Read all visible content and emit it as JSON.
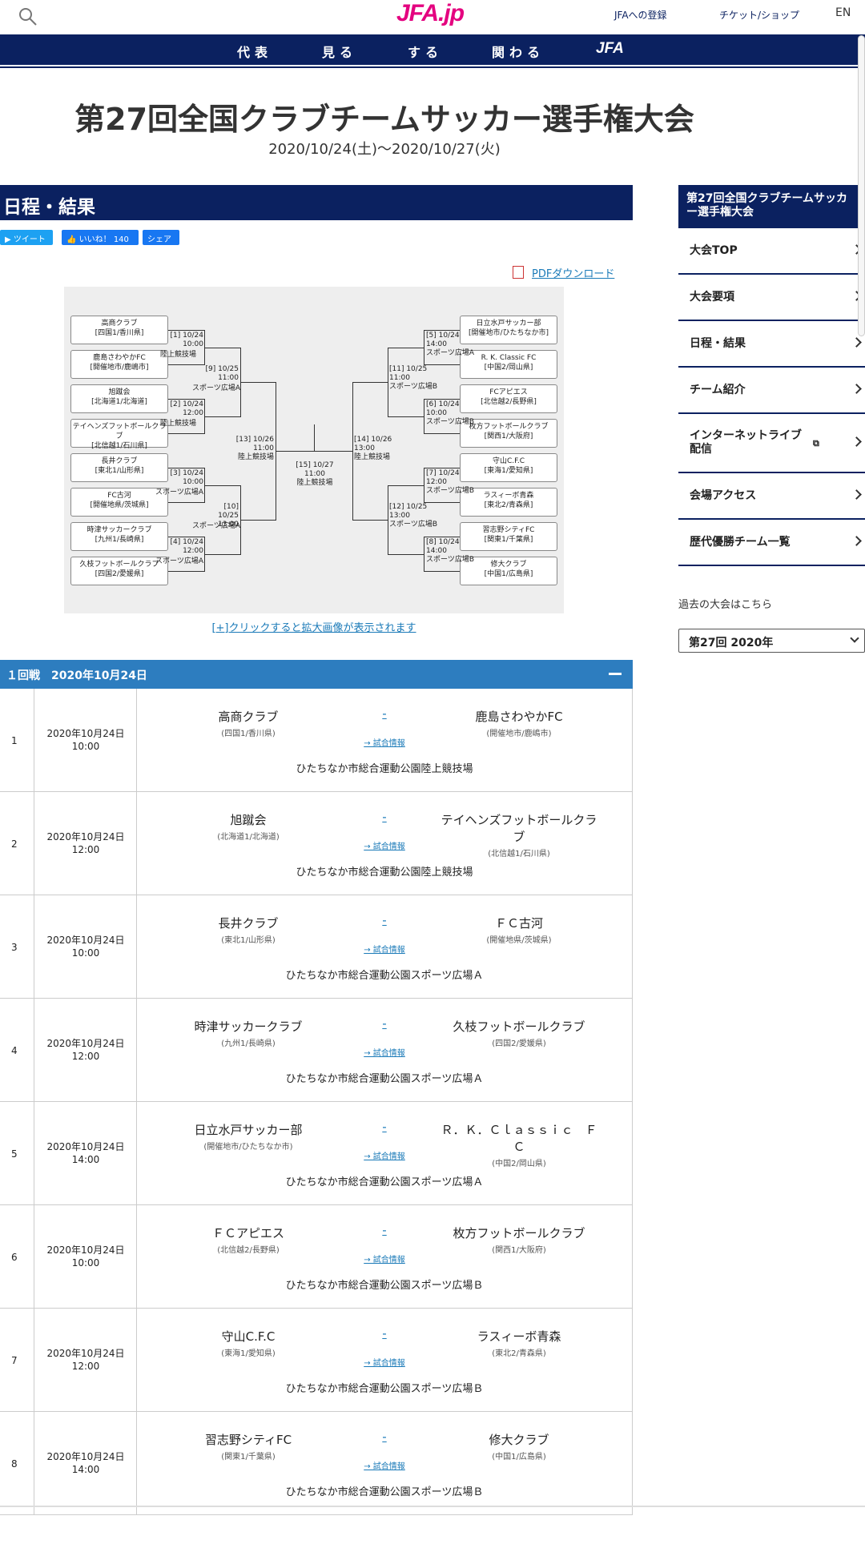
{
  "header": {
    "logo": "JFA.jp",
    "register": "JFAへの登録",
    "tickets": "チケット/ショップ",
    "lang": "EN",
    "nav": [
      "代表",
      "見る",
      "する",
      "関わる"
    ],
    "nav_jfa": "JFA"
  },
  "page": {
    "title": "第27回全国クラブチームサッカー選手権大会",
    "dates": "2020/10/24(土)〜2020/10/27(火)",
    "section": "日程・結果",
    "tweet": "ツイート",
    "like": "いいね！ 140",
    "share": "シェア",
    "pdf": "PDFダウンロード",
    "zoom_link": "[+]クリックすると拡大画像が表示されます"
  },
  "bracket": {
    "left_teams": [
      [
        "高商クラブ",
        "[四国1/香川県]"
      ],
      [
        "鹿島さわやかFC",
        "[開催地市/鹿嶋市]"
      ],
      [
        "旭蹴会",
        "[北海道1/北海道]"
      ],
      [
        "テイヘンズフットボールクラブ",
        "[北信越1/石川県]"
      ],
      [
        "長井クラブ",
        "[東北1/山形県]"
      ],
      [
        "FC古河",
        "[開催地県/茨城県]"
      ],
      [
        "時津サッカークラブ",
        "[九州1/長崎県]"
      ],
      [
        "久枝フットボールクラブ",
        "[四国2/愛媛県]"
      ]
    ],
    "right_teams": [
      [
        "日立水戸サッカー部",
        "[開催地市/ひたちなか市]"
      ],
      [
        "R. K. Classic FC",
        "[中国2/岡山県]"
      ],
      [
        "FCアピエス",
        "[北信越2/長野県]"
      ],
      [
        "枚方フットボールクラブ",
        "[関西1/大阪府]"
      ],
      [
        "守山C.F.C",
        "[東海1/愛知県]"
      ],
      [
        "ラスィーボ青森",
        "[東北2/青森県]"
      ],
      [
        "習志野シティFC",
        "[関東1/千葉県]"
      ],
      [
        "修大クラブ",
        "[中国1/広島県]"
      ]
    ],
    "labels": {
      "m1": [
        "[1] 10/24",
        "10:00",
        "陸上競技場"
      ],
      "m2": [
        "[2] 10/24",
        "12:00",
        "陸上競技場"
      ],
      "m3": [
        "[3] 10/24",
        "10:00",
        "スポーツ広場A"
      ],
      "m4": [
        "[4] 10/24",
        "12:00",
        "スポーツ広場A"
      ],
      "m5": [
        "[5] 10/24",
        "14:00",
        "スポーツ広場A"
      ],
      "m6": [
        "[6] 10/24",
        "10:00",
        "スポーツ広場B"
      ],
      "m7": [
        "[7] 10/24",
        "12:00",
        "スポーツ広場B"
      ],
      "m8": [
        "[8] 10/24",
        "14:00",
        "スポーツ広場B"
      ],
      "m9": [
        "[9] 10/25",
        "11:00",
        "スポーツ広場A"
      ],
      "m10": [
        "[10] 10/25",
        "13:00",
        "スポーツ広場A"
      ],
      "m11": [
        "[11] 10/25",
        "11:00",
        "スポーツ広場B"
      ],
      "m12": [
        "[12] 10/25",
        "13:00",
        "スポーツ広場B"
      ],
      "m13": [
        "[13] 10/26",
        "11:00",
        "陸上競技場"
      ],
      "m14": [
        "[14] 10/26",
        "13:00",
        "陸上競技場"
      ],
      "m15": [
        "[15] 10/27",
        "11:00",
        "陸上競技場"
      ]
    }
  },
  "round": {
    "title": "１回戦　2020年10月24日"
  },
  "matches": [
    {
      "no": "1",
      "date": "2020年10月24日",
      "time": "10:00",
      "home": "高商クラブ",
      "home_pref": "(四国1/香川県)",
      "away": "鹿島さわやかFC",
      "away_pref": "(開催地市/鹿嶋市)",
      "score": "-",
      "info": "→ 試合情報",
      "venue": "ひたちなか市総合運動公園陸上競技場"
    },
    {
      "no": "2",
      "date": "2020年10月24日",
      "time": "12:00",
      "home": "旭蹴会",
      "home_pref": "(北海道1/北海道)",
      "away": "テイヘンズフットボールクラブ",
      "away_pref": "(北信越1/石川県)",
      "score": "-",
      "info": "→ 試合情報",
      "venue": "ひたちなか市総合運動公園陸上競技場"
    },
    {
      "no": "3",
      "date": "2020年10月24日",
      "time": "10:00",
      "home": "長井クラブ",
      "home_pref": "(東北1/山形県)",
      "away": "ＦＣ古河",
      "away_pref": "(開催地県/茨城県)",
      "score": "-",
      "info": "→ 試合情報",
      "venue": "ひたちなか市総合運動公園スポーツ広場Ａ"
    },
    {
      "no": "4",
      "date": "2020年10月24日",
      "time": "12:00",
      "home": "時津サッカークラブ",
      "home_pref": "(九州1/長崎県)",
      "away": "久枝フットボールクラブ",
      "away_pref": "(四国2/愛媛県)",
      "score": "-",
      "info": "→ 試合情報",
      "venue": "ひたちなか市総合運動公園スポーツ広場Ａ"
    },
    {
      "no": "5",
      "date": "2020年10月24日",
      "time": "14:00",
      "home": "日立水戸サッカー部",
      "home_pref": "(開催地市/ひたちなか市)",
      "away": "Ｒ．Ｋ．Ｃｌａｓｓｉｃ　ＦＣ",
      "away_pref": "(中国2/岡山県)",
      "score": "-",
      "info": "→ 試合情報",
      "venue": "ひたちなか市総合運動公園スポーツ広場Ａ"
    },
    {
      "no": "6",
      "date": "2020年10月24日",
      "time": "10:00",
      "home": "ＦＣアピエス",
      "home_pref": "(北信越2/長野県)",
      "away": "枚方フットボールクラブ",
      "away_pref": "(関西1/大阪府)",
      "score": "-",
      "info": "→ 試合情報",
      "venue": "ひたちなか市総合運動公園スポーツ広場Ｂ"
    },
    {
      "no": "7",
      "date": "2020年10月24日",
      "time": "12:00",
      "home": "守山C.F.C",
      "home_pref": "(東海1/愛知県)",
      "away": "ラスィーボ青森",
      "away_pref": "(東北2/青森県)",
      "score": "-",
      "info": "→ 試合情報",
      "venue": "ひたちなか市総合運動公園スポーツ広場Ｂ"
    },
    {
      "no": "8",
      "date": "2020年10月24日",
      "time": "14:00",
      "home": "習志野シティFC",
      "home_pref": "(関東1/千葉県)",
      "away": "修大クラブ",
      "away_pref": "(中国1/広島県)",
      "score": "-",
      "info": "→ 試合情報",
      "venue": "ひたちなか市総合運動公園スポーツ広場Ｂ"
    }
  ],
  "sidebar": {
    "title": "第27回全国クラブチームサッカー選手権大会",
    "items": [
      "大会TOP",
      "大会要項",
      "日程・結果",
      "チーム紹介",
      "インターネットライブ配信",
      "会場アクセス",
      "歴代優勝チーム一覧"
    ],
    "past_label": "過去の大会はこちら",
    "past_selected": "第27回 2020年"
  }
}
